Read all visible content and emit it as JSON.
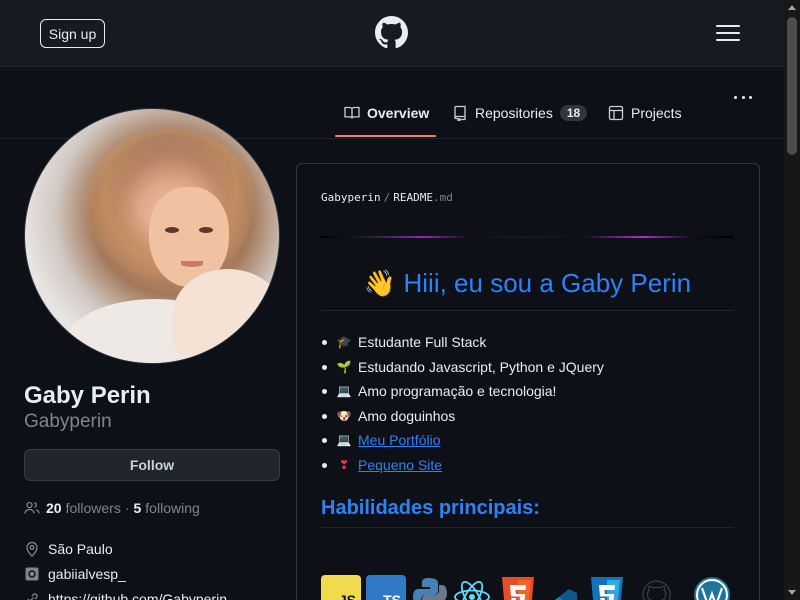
{
  "header": {
    "signup_label": "Sign up",
    "logo_icon": "github-logo-icon",
    "menu_icon": "hamburger-menu-icon"
  },
  "tabs": [
    {
      "label": "Overview",
      "icon": "book-icon",
      "active": true
    },
    {
      "label": "Repositories",
      "icon": "repo-icon",
      "count": "18"
    },
    {
      "label": "Projects",
      "icon": "table-icon"
    }
  ],
  "profile": {
    "name": "Gaby Perin",
    "login": "Gabyperin",
    "follow_label": "Follow",
    "followers_count": "20",
    "followers_label": "followers",
    "separator": "·",
    "following_count": "5",
    "following_label": "following",
    "location": "São Paulo",
    "instagram": "gabiialvesp_",
    "website": "https://github.com/Gabyperin"
  },
  "readme": {
    "owner": "Gabyperin",
    "file": "README",
    "ext": ".md",
    "heading_emoji": "👋",
    "heading": "Hiii, eu sou a Gaby Perin",
    "items": [
      {
        "icon": "graduation-cap-icon",
        "glyph": "🎓",
        "text": "Estudante Full Stack",
        "link": false
      },
      {
        "icon": "seedling-icon",
        "glyph": "🌱",
        "text": "Estudando Javascript, Python e JQuery",
        "link": false
      },
      {
        "icon": "laptop-icon",
        "glyph": "💻",
        "text": "Amo programação e tecnologia!",
        "link": false
      },
      {
        "icon": "dog-icon",
        "glyph": "🐶",
        "text": "Amo doguinhos",
        "link": false
      },
      {
        "icon": "laptop-icon",
        "glyph": "💻",
        "text": "Meu Portfólio",
        "link": true
      },
      {
        "icon": "heart-icon",
        "glyph": "❣",
        "text": "Pequeno Site",
        "link": true
      }
    ],
    "skills_title": "Habilidades principais:",
    "skills": [
      {
        "name": "javascript-icon",
        "label": "JS"
      },
      {
        "name": "typescript-icon",
        "label": "TS"
      },
      {
        "name": "python-icon"
      },
      {
        "name": "react-icon"
      },
      {
        "name": "html5-icon"
      },
      {
        "name": "vscode-icon"
      },
      {
        "name": "css3-icon"
      },
      {
        "name": "github-icon"
      },
      {
        "name": "wordpress-icon"
      }
    ]
  },
  "colors": {
    "accent_link": "#2f81f7",
    "tab_underline": "#f78166",
    "background": "#0d1117",
    "header_bg": "#161b22"
  }
}
